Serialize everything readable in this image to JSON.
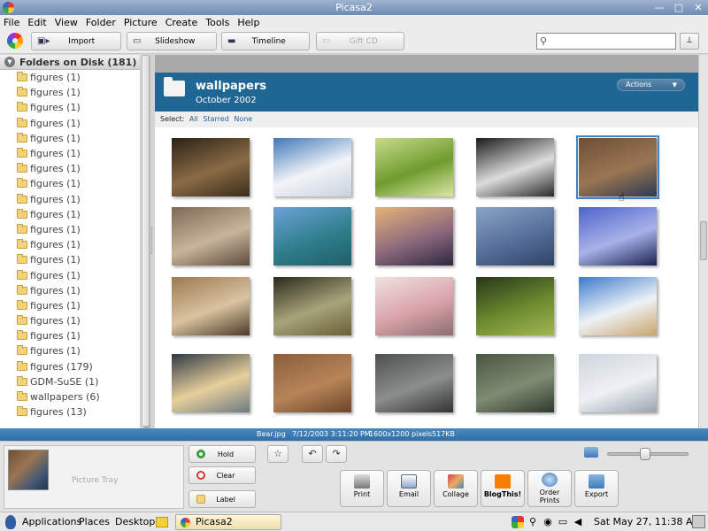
{
  "window": {
    "title": "Picasa2"
  },
  "menu": [
    "File",
    "Edit",
    "View",
    "Folder",
    "Picture",
    "Create",
    "Tools",
    "Help"
  ],
  "toolbar": {
    "import_label": "Import",
    "slideshow_label": "Slideshow",
    "timeline_label": "Timeline",
    "giftcd_label": "Gift CD",
    "search_placeholder": "",
    "search_value": ""
  },
  "left_panel": {
    "header": "Folders on Disk (181)",
    "folders": [
      "figures (1)",
      "figures (1)",
      "figures (1)",
      "figures (1)",
      "figures (1)",
      "figures (1)",
      "figures (1)",
      "figures (1)",
      "figures (1)",
      "figures (1)",
      "figures (1)",
      "figures (1)",
      "figures (1)",
      "figures (1)",
      "figures (1)",
      "figures (1)",
      "figures (1)",
      "figures (1)",
      "figures (1)",
      "figures (179)",
      "GDM-SuSE (1)",
      "wallpapers (6)",
      "figures (13)"
    ]
  },
  "album": {
    "title": "wallpapers",
    "date": "October 2002",
    "actions_label": "Actions",
    "select_label": "Select:",
    "select_all": "All",
    "select_starred": "Starred",
    "select_none": "None"
  },
  "thumbnails": [
    {
      "name": "lake-sunset",
      "colors": [
        "#2b2216",
        "#8a6b44",
        "#3a2c1c"
      ]
    },
    {
      "name": "snow-cabin",
      "colors": [
        "#3f77b8",
        "#f2f4f8",
        "#c9d3de"
      ]
    },
    {
      "name": "green-leaf",
      "colors": [
        "#c8dc8a",
        "#6f9b2e",
        "#dbe8a6"
      ]
    },
    {
      "name": "monkey",
      "colors": [
        "#1b1b1b",
        "#dcdcdc",
        "#2a2a2a"
      ]
    },
    {
      "name": "bear",
      "colors": [
        "#6c4f36",
        "#9a7552",
        "#2d3a52"
      ]
    },
    {
      "name": "sea-lions",
      "colors": [
        "#7e6a55",
        "#c7b49b",
        "#5d4b3b"
      ]
    },
    {
      "name": "church-lake",
      "colors": [
        "#6da2d8",
        "#2f7f8c",
        "#1f5e6a"
      ]
    },
    {
      "name": "mountain-dusk",
      "colors": [
        "#e6b27a",
        "#8d6a7c",
        "#2e2840"
      ]
    },
    {
      "name": "blue-mountains",
      "colors": [
        "#8aa3c6",
        "#566f99",
        "#304267"
      ]
    },
    {
      "name": "rocky-shore",
      "colors": [
        "#4e63c9",
        "#a8b2e8",
        "#1b2250"
      ]
    },
    {
      "name": "wolf",
      "colors": [
        "#9c7a52",
        "#d9c3a0",
        "#4a3a28"
      ]
    },
    {
      "name": "turtle",
      "colors": [
        "#2c2a1b",
        "#a7a47b",
        "#6a5f34"
      ]
    },
    {
      "name": "cherry-blossoms",
      "colors": [
        "#f1e1e0",
        "#d9a3aa",
        "#8b6e6e"
      ]
    },
    {
      "name": "forest-meadow",
      "colors": [
        "#27361a",
        "#6c8b2f",
        "#a3b653"
      ]
    },
    {
      "name": "beach-clouds",
      "colors": [
        "#3b7ac9",
        "#eef2f7",
        "#c9a46b"
      ]
    },
    {
      "name": "above-clouds",
      "colors": [
        "#2f3a44",
        "#e8cf9c",
        "#6d7b83"
      ]
    },
    {
      "name": "brown-texture",
      "colors": [
        "#8a5f3c",
        "#b78458",
        "#6c4529"
      ]
    },
    {
      "name": "gray-camo",
      "colors": [
        "#4d5150",
        "#8a8f8c",
        "#2f3332"
      ]
    },
    {
      "name": "green-marble",
      "colors": [
        "#495742",
        "#7e8c73",
        "#2f3a2c"
      ]
    },
    {
      "name": "gdm-logo",
      "colors": [
        "#cfd5dc",
        "#eef1f4",
        "#9aa4b0"
      ]
    }
  ],
  "statusbar": {
    "filename": "Bear.jpg",
    "datetime": "7/12/2003 3:11:20 PM",
    "dimensions": "1600x1200 pixels",
    "filesize": "517KB"
  },
  "tray": {
    "label": "Picture Tray",
    "hold_label": "Hold",
    "clear_label": "Clear",
    "label_label": "Label"
  },
  "actions": {
    "print": "Print",
    "email": "Email",
    "collage": "Collage",
    "blogthis": "BlogThis!",
    "order_prints_1": "Order",
    "order_prints_2": "Prints",
    "export": "Export"
  },
  "zoom": {
    "level": 0.45
  },
  "taskbar": {
    "applications": "Applications",
    "places": "Places",
    "desktop": "Desktop",
    "task_label": "Picasa2",
    "clock": "Sat May 27, 11:38 AM"
  },
  "colors": {
    "banner": "#1f6695",
    "statusbar": "#2f6ea8",
    "selection": "#3d84c6"
  }
}
